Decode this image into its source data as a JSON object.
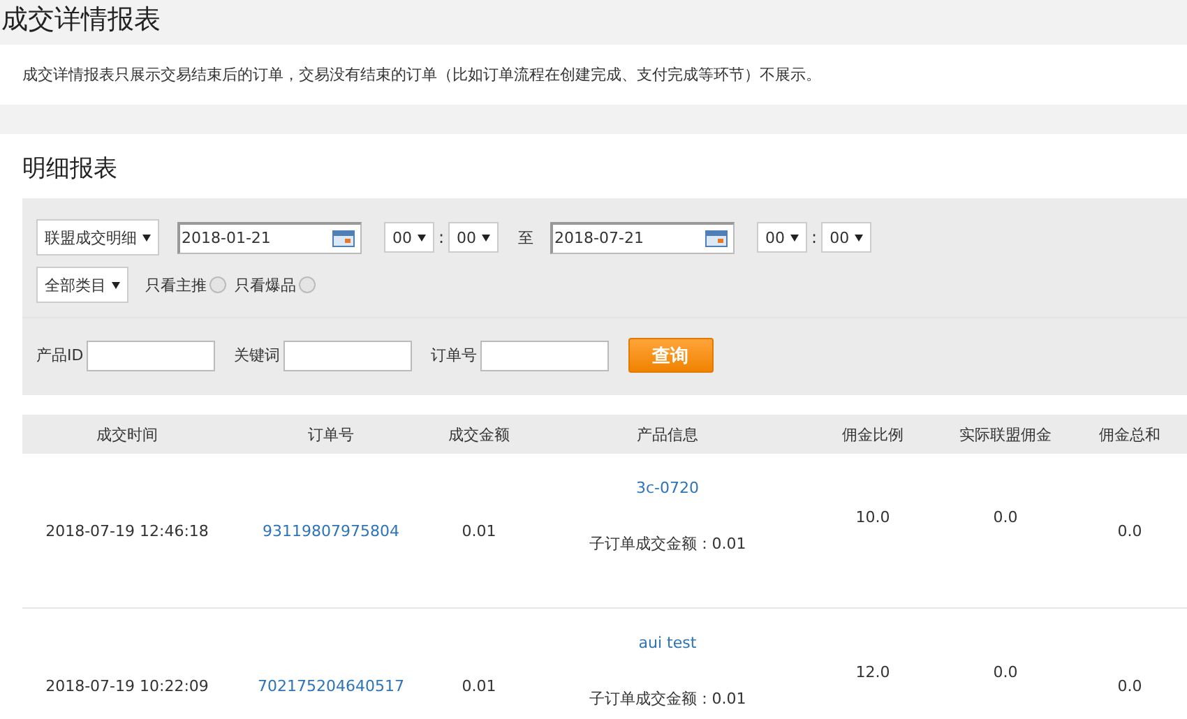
{
  "page_title": "成交详情报表",
  "notice": "成交详情报表只展示交易结束后的订单，交易没有结束的订单（比如订单流程在创建完成、支付完成等环节）不展示。",
  "section_title": "明细报表",
  "filters": {
    "report_type": "联盟成交明细",
    "start": {
      "date": "2018-01-21",
      "hour": "00",
      "separator": ":",
      "minute": "00"
    },
    "range_word": "至",
    "end": {
      "date": "2018-07-21",
      "hour": "00",
      "separator": ":",
      "minute": "00"
    },
    "category": "全部类目",
    "options": [
      {
        "label": "只看主推",
        "selected": false
      },
      {
        "label": "只看爆品",
        "selected": false
      }
    ],
    "fields": [
      {
        "label": "产品ID"
      },
      {
        "label": "关键词"
      },
      {
        "label": "订单号"
      }
    ],
    "search_button": "查询"
  },
  "table": {
    "columns": [
      "成交时间",
      "订单号",
      "成交金额",
      "产品信息",
      "佣金比例",
      "实际联盟佣金",
      "佣金总和"
    ],
    "rows": [
      {
        "time": "2018-07-19 12:46:18",
        "order_no": "93119807975804",
        "amount": "0.01",
        "product": "3c-0720",
        "sub_amount": "子订单成交金额：0.01",
        "rate": "10.0",
        "actual_commission": "0.0",
        "total_commission": "0.0"
      },
      {
        "time": "2018-07-19 10:22:09",
        "order_no": "702175204640517",
        "amount": "0.01",
        "product": "aui test",
        "sub_amount": "子订单成交金额：0.01",
        "rate": "12.0",
        "actual_commission": "0.0",
        "total_commission": "0.0"
      }
    ]
  }
}
